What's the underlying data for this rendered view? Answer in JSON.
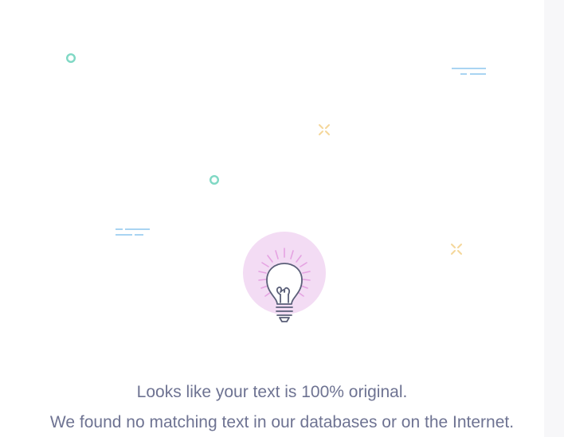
{
  "result": {
    "headline": "Looks like your text is 100% original.",
    "detail": "We found no matching text in our databases or on the Internet."
  },
  "illustration": {
    "icon": "lightbulb-icon",
    "halo_color": "#f3dcf4",
    "ray_color": "#e5a3e2",
    "line_color": "#5a5f78"
  },
  "decorations": {
    "circle_color": "#7fd8c4",
    "dash_color": "#a9d4f2",
    "sparkle_color": "#f4d79a"
  },
  "colors": {
    "text": "#6e7392",
    "background": "#ffffff",
    "gutter": "#f7f7f9"
  }
}
